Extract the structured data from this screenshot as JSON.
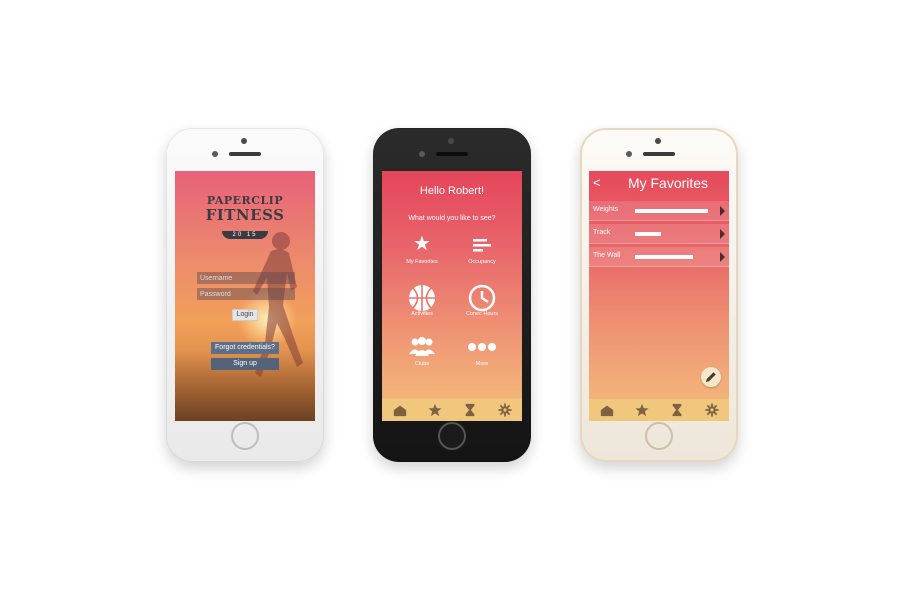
{
  "colors": {
    "tab_icon": "#7d6242",
    "tabbar_bg": "#f1c77e",
    "button_blue": "#5d6e86"
  },
  "login_screen": {
    "logo": {
      "line1": "PAPERCLIP",
      "line2": "FITNESS",
      "year": "20 15"
    },
    "username_placeholder": "Username",
    "password_placeholder": "Password",
    "login_label": "Login",
    "forgot_label": "Forgot credentials?",
    "signup_label": "Sign up"
  },
  "home_screen": {
    "greeting": "Hello Robert!",
    "question": "What would you like to see?",
    "tiles": [
      {
        "label": "My Favorites",
        "icon": "star-icon"
      },
      {
        "label": "Occupancy",
        "icon": "bars-icon"
      },
      {
        "label": "Activities",
        "icon": "basketball-icon"
      },
      {
        "label": "Conec Hours",
        "icon": "clock-icon"
      },
      {
        "label": "Clubs",
        "icon": "group-icon"
      },
      {
        "label": "More",
        "icon": "more-dots-icon"
      }
    ]
  },
  "tabbar": {
    "tabs": [
      {
        "icon": "home-icon"
      },
      {
        "icon": "star-icon"
      },
      {
        "icon": "hourglass-icon"
      },
      {
        "icon": "gear-icon"
      }
    ]
  },
  "favorites_screen": {
    "back_glyph": "<",
    "title": "My Favorites",
    "items": [
      {
        "name": "Weights",
        "level": 0.91
      },
      {
        "name": "Track",
        "level": 0.33
      },
      {
        "name": "The Wall",
        "level": 0.73
      }
    ]
  }
}
